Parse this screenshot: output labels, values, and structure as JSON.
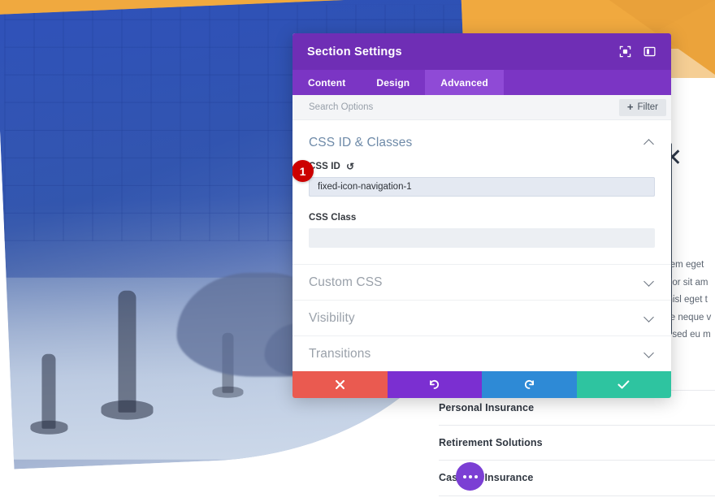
{
  "modal": {
    "title": "Section Settings",
    "header_icons": [
      {
        "name": "focus-icon",
        "label": "Focus"
      },
      {
        "name": "layout-panel-icon",
        "label": "Layout"
      }
    ],
    "tabs": [
      {
        "label": "Content",
        "active": false
      },
      {
        "label": "Design",
        "active": false
      },
      {
        "label": "Advanced",
        "active": true
      }
    ],
    "search": {
      "placeholder": "Search Options",
      "value": ""
    },
    "filter": {
      "plus": "+",
      "label": "Filter"
    },
    "open_section": {
      "title": "CSS ID & Classes",
      "fields": [
        {
          "label": "CSS ID",
          "reset_icon": "↺",
          "value": "fixed-icon-navigation-1",
          "placeholder": "",
          "badge": "1"
        },
        {
          "label": "CSS Class",
          "value": "",
          "placeholder": ""
        }
      ]
    },
    "collapsed_sections": [
      {
        "title": "Custom CSS"
      },
      {
        "title": "Visibility"
      },
      {
        "title": "Transitions"
      }
    ],
    "footer_buttons": [
      {
        "name": "cancel-button",
        "icon": "close-icon",
        "color": "#ea5a50"
      },
      {
        "name": "undo-button",
        "icon": "undo-icon",
        "color": "#7b2fd1"
      },
      {
        "name": "redo-button",
        "icon": "redo-icon",
        "color": "#2e8ad6"
      },
      {
        "name": "save-button",
        "icon": "check-icon",
        "color": "#2ec4a0"
      }
    ]
  },
  "page": {
    "close_glyph": "✕",
    "body_lines": [
      "r sem eget",
      "dolor sit am",
      "a nisl eget t",
      "que neque v",
      "us sed eu m"
    ],
    "links": [
      "Personal Insurance",
      "Retirement Solutions",
      "Casualty Insurance"
    ],
    "fab": {
      "name": "chat-bubble-button",
      "dots": 3
    }
  },
  "colors": {
    "brand_purple": "#6f2eb5",
    "tab_bar_purple": "#7b35c4",
    "tab_active_purple": "#8f4ad6",
    "section_heading_blue": "#6e8aa8",
    "badge_red": "#cc0000",
    "hero_orange": "#f0a93f",
    "hero_blue": "#41609f",
    "cancel_red": "#ea5a50",
    "undo_purple": "#7b2fd1",
    "redo_blue": "#2e8ad6",
    "save_green": "#2ec4a0"
  }
}
